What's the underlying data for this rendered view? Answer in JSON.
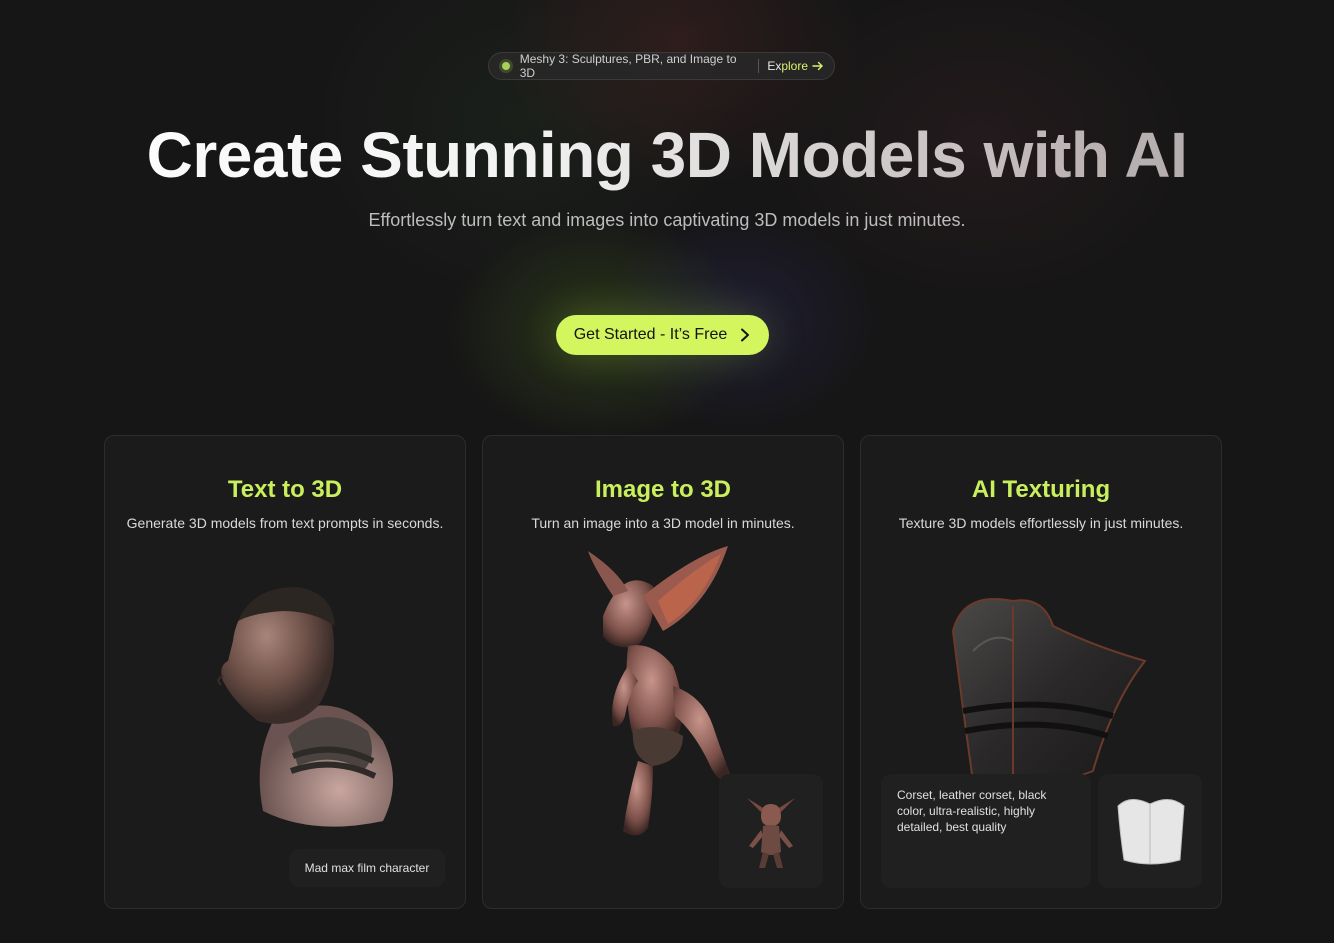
{
  "announcement": {
    "text": "Meshy 3: Sculptures, PBR, and Image to 3D",
    "link_part1": "Ex",
    "link_part2": "plore"
  },
  "hero": {
    "title": "Create Stunning 3D Models with AI",
    "subtitle": "Effortlessly turn text and images into captivating 3D models in just minutes.",
    "cta_label": "Get Started - It’s Free"
  },
  "cards": [
    {
      "title": "Text to 3D",
      "description": "Generate 3D models from text prompts in seconds.",
      "prompt": "Mad max film character"
    },
    {
      "title": "Image to 3D",
      "description": "Turn an image into a 3D model in minutes."
    },
    {
      "title": "AI Texturing",
      "description": "Texture 3D models effortlessly in just minutes.",
      "prompt": "Corset, leather corset, black color, ultra-realistic, highly detailed, best quality"
    }
  ],
  "colors": {
    "accent": "#d3f55e",
    "card_title": "#c9ef5c",
    "background": "#161616"
  },
  "icons": [
    "status-dot-icon",
    "arrow-right-icon",
    "chevron-right-icon"
  ]
}
